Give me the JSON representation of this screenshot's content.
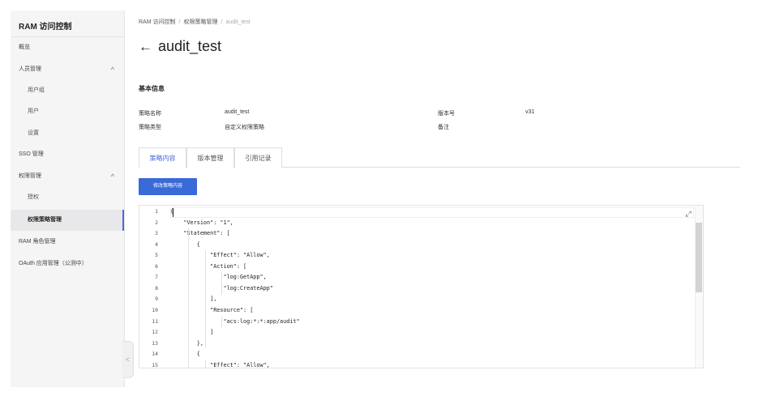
{
  "sidebar": {
    "title": "RAM 访问控制",
    "items": [
      {
        "label": "概览"
      },
      {
        "label": "人员管理",
        "chevron": "^"
      },
      {
        "label": "用户组"
      },
      {
        "label": "用户"
      },
      {
        "label": "设置"
      },
      {
        "label": "SSO 管理"
      },
      {
        "label": "权限管理",
        "chevron": "^"
      },
      {
        "label": "授权"
      },
      {
        "label": "权限策略管理"
      },
      {
        "label": "RAM 角色管理"
      },
      {
        "label": "OAuth 应用管理（公测中）"
      }
    ],
    "collapse_glyph": "<"
  },
  "breadcrumb": {
    "items": [
      "RAM 访问控制",
      "权限策略管理",
      "audit_test"
    ],
    "sep": "/"
  },
  "page": {
    "back_glyph": "←",
    "title": "audit_test"
  },
  "basic_info": {
    "title": "基本信息",
    "policy_name_label": "策略名称",
    "policy_name_value": "audit_test",
    "policy_type_label": "策略类型",
    "policy_type_value": "自定义权限策略",
    "version_label": "版本号",
    "version_value": "v31",
    "note_label": "备注"
  },
  "tabs": [
    "策略内容",
    "版本管理",
    "引用记录"
  ],
  "edit_button": "修改策略内容",
  "editor": {
    "expand_glyph": "⤢",
    "lines": [
      {
        "n": "1",
        "text": "{"
      },
      {
        "n": "2",
        "text": "    \"Version\": \"1\","
      },
      {
        "n": "3",
        "text": "    \"Statement\": ["
      },
      {
        "n": "4",
        "text": "        {"
      },
      {
        "n": "5",
        "text": "            \"Effect\": \"Allow\","
      },
      {
        "n": "6",
        "text": "            \"Action\": ["
      },
      {
        "n": "7",
        "text": "                \"log:GetApp\","
      },
      {
        "n": "8",
        "text": "                \"log:CreateApp\""
      },
      {
        "n": "9",
        "text": "            ],"
      },
      {
        "n": "10",
        "text": "            \"Resource\": ["
      },
      {
        "n": "11",
        "text": "                \"acs:log:*:*:app/audit\""
      },
      {
        "n": "12",
        "text": "            ]"
      },
      {
        "n": "13",
        "text": "        },"
      },
      {
        "n": "14",
        "text": "        {"
      },
      {
        "n": "15",
        "text": "            \"Effect\": \"Allow\","
      }
    ]
  }
}
